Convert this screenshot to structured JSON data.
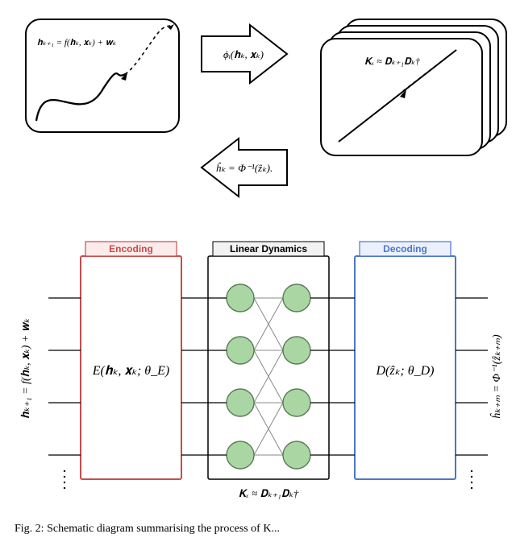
{
  "figure": {
    "caption": "Fig. 2: Schematic diagram summarising the process of K...",
    "top": {
      "nonlinear_eq": "𝐡ₖ₊₁ = f(𝐡ₖ, 𝐱ₖ) + 𝐰ₖ",
      "lift_fn": "ϕᵢ(𝐡ₖ, 𝐱ₖ)",
      "koopman": "𝐊ₓ ≈ 𝐃ₖ₊₁𝐃ₖ†",
      "inverse_fn": "ĥₖ = Φ⁻¹(ẑₖ)."
    },
    "blocks": {
      "encoding_title": "Encoding",
      "dynamics_title": "Linear Dynamics",
      "decoding_title": "Decoding",
      "encoder_fn": "E(𝐡ₖ, 𝐱ₖ; θ_E)",
      "decoder_fn": "D(ẑₖ; θ_D)",
      "left_axis": "𝐡ₖ₊₁ = f(𝐡ₖ, 𝐱ₖ) + 𝐰ₖ",
      "right_axis": "ĥₖ₊ₘ = Φ⁻¹(ẑₖ₊ₘ)",
      "bottom_eq": "𝐊ₓ ≈ 𝐃ₖ₊₁𝐃ₖ†"
    },
    "colors": {
      "encoder_stroke": "#c84c4c",
      "encoder_fill": "#fbebeb",
      "decoder_stroke": "#4c76c8",
      "decoder_fill": "#ebf0fb",
      "node": "#a9d6a3",
      "node_stroke": "#5a7a56",
      "box": "#000000"
    }
  }
}
